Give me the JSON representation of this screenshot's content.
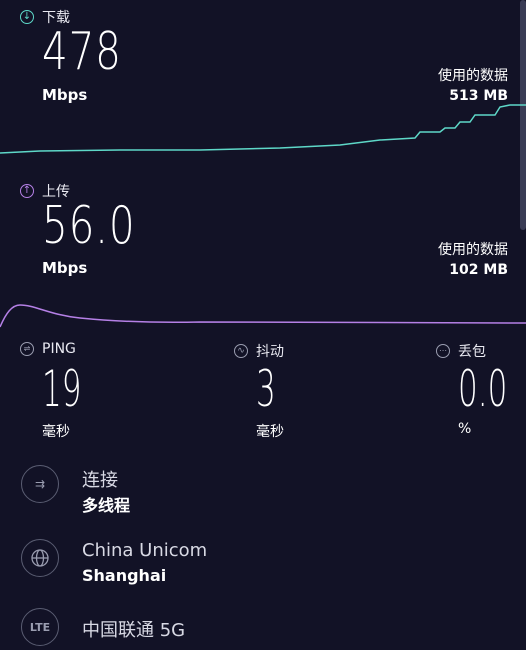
{
  "colors": {
    "bg": "#121226",
    "download_accent": "#5ed8c8",
    "upload_accent": "#b580e6"
  },
  "download": {
    "label": "下载",
    "value": "478",
    "unit": "Mbps",
    "data_used_label": "使用的数据",
    "data_used_value": "513 MB",
    "icon": "download-arrow-icon"
  },
  "upload": {
    "label": "上传",
    "value": "56.0",
    "unit": "Mbps",
    "data_used_label": "使用的数据",
    "data_used_value": "102 MB",
    "icon": "upload-arrow-icon"
  },
  "metrics": {
    "ping": {
      "label": "PING",
      "value": "19",
      "unit": "毫秒",
      "icon": "ping-icon"
    },
    "jitter": {
      "label": "抖动",
      "value": "3",
      "unit": "毫秒",
      "icon": "jitter-icon"
    },
    "loss": {
      "label": "丢包",
      "value": "0.0",
      "unit": "%",
      "icon": "packet-loss-icon"
    }
  },
  "connection": {
    "line1": "连接",
    "line2": "多线程",
    "icon": "multi-connection-icon"
  },
  "server": {
    "line1": "China Unicom",
    "line2": "Shanghai",
    "icon": "globe-icon"
  },
  "network": {
    "line1": "中国联通 5G",
    "icon_text": "LTE",
    "icon": "lte-icon"
  }
}
